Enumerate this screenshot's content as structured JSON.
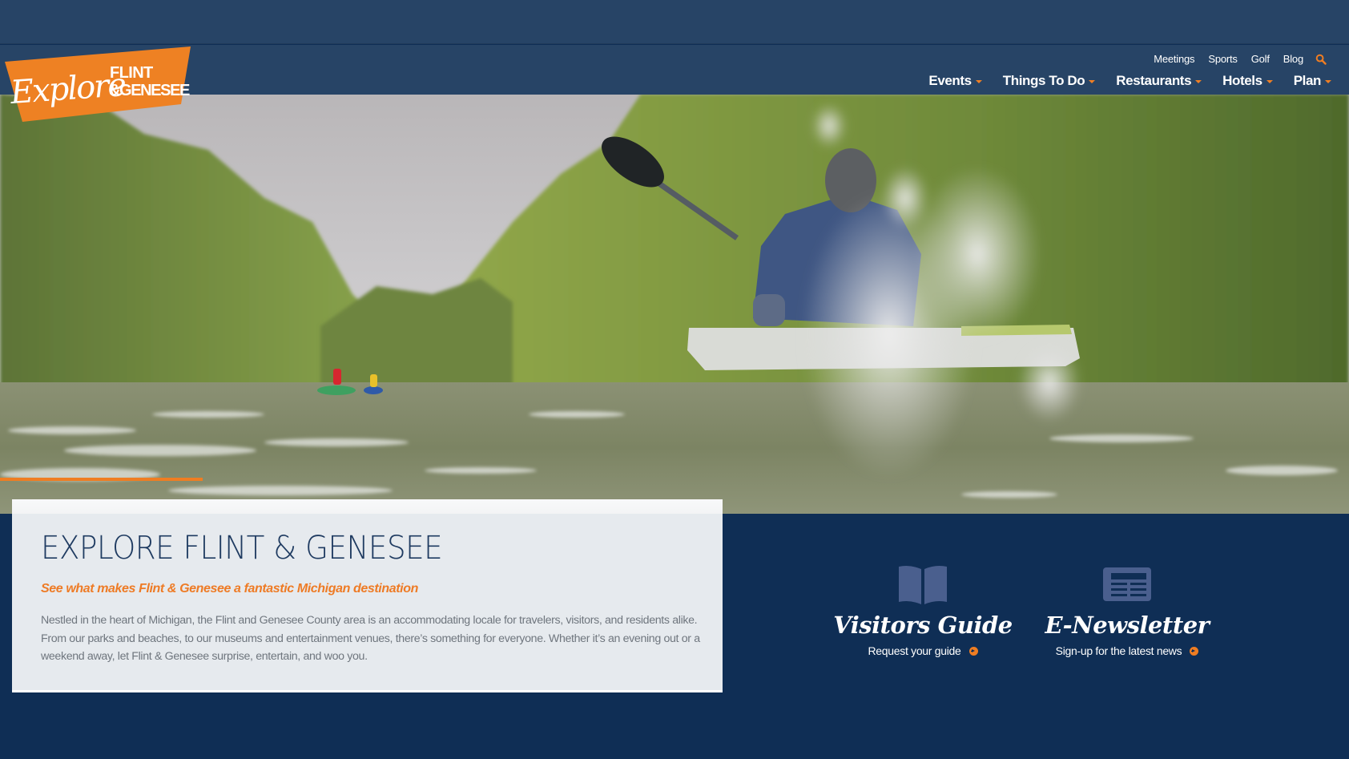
{
  "brand": {
    "logo_script": "Explore",
    "logo_line1": "FLINT",
    "logo_line2": "&GENESEE",
    "accent_color": "#ef7d22",
    "navy_color": "#0f2e55",
    "header_color": "#274466"
  },
  "utility_nav": {
    "items": [
      "Meetings",
      "Sports",
      "Golf",
      "Blog"
    ],
    "search_icon": "search-icon"
  },
  "main_nav": {
    "items": [
      {
        "label": "Events",
        "icon": "caret-down-icon"
      },
      {
        "label": "Things To Do",
        "icon": "caret-down-icon"
      },
      {
        "label": "Restaurants",
        "icon": "caret-down-icon"
      },
      {
        "label": "Hotels",
        "icon": "caret-down-icon"
      },
      {
        "label": "Plan",
        "icon": "caret-down-icon"
      }
    ]
  },
  "hero": {
    "image_description": "Kayakers paddling down a tree-lined river",
    "slide_progress": 0.15
  },
  "intro": {
    "title": "EXPLORE FLINT & GENESEE",
    "subtitle": "See what makes Flint & Genesee a fantastic Michigan destination",
    "body": "Nestled in the heart of Michigan, the Flint and Genesee County area is an accommodating locale for travelers, visitors, and residents alike. From our parks and beaches, to our museums and entertainment venues, there’s something for everyone. Whether it’s an evening out or a weekend away, let Flint & Genesee surprise, entertain, and woo you."
  },
  "features": [
    {
      "title": "Visitors Guide",
      "link": "Request your guide",
      "icon": "book-icon"
    },
    {
      "title": "E-Newsletter",
      "link": "Sign-up for the latest news",
      "icon": "newspaper-icon"
    }
  ]
}
